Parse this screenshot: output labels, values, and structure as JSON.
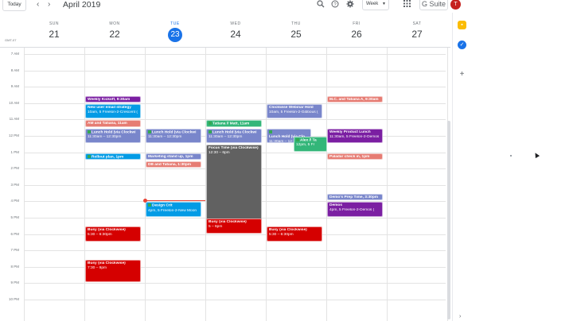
{
  "toolbar": {
    "today_label": "Today",
    "prev_icon": "chevron-left-icon",
    "next_icon": "chevron-right-icon",
    "month_title": "April 2019",
    "search_icon": "search-icon",
    "help_icon": "help-icon",
    "settings_icon": "gear-icon",
    "view_label": "Week",
    "apps_icon": "apps-grid-icon",
    "suite_label": "G Suite",
    "avatar_initial": "T"
  },
  "timezone": "GMT-07",
  "days": [
    {
      "dow": "SUN",
      "num": "21",
      "today": false
    },
    {
      "dow": "MON",
      "num": "22",
      "today": false
    },
    {
      "dow": "TUE",
      "num": "23",
      "today": true
    },
    {
      "dow": "WED",
      "num": "24",
      "today": false
    },
    {
      "dow": "THU",
      "num": "25",
      "today": false
    },
    {
      "dow": "FRI",
      "num": "26",
      "today": false
    },
    {
      "dow": "SAT",
      "num": "27",
      "today": false
    }
  ],
  "hours": [
    "7 AM",
    "8 AM",
    "9 AM",
    "10 AM",
    "11 AM",
    "12 PM",
    "1 PM",
    "2 PM",
    "3 PM",
    "4 PM",
    "5 PM",
    "6 PM",
    "7 PM",
    "8 PM",
    "9 PM",
    "10 PM"
  ],
  "colors": {
    "purple": "#7b1fa2",
    "blue": "#039be5",
    "red_light": "#e67c73",
    "lavender": "#7986cb",
    "green": "#33b679",
    "red": "#d50000",
    "graphite": "#616161",
    "today_blue": "#1a73e8",
    "now_red": "#ea4335"
  },
  "events": [
    {
      "title": "Weekly Kickoff, 9:30am",
      "sub": "",
      "flag": false
    },
    {
      "title": "New user email strategy",
      "sub": "10am, 5 Freelon-2-Crescent (",
      "flag": false
    },
    {
      "title": "AM and Tatiana, 11am",
      "sub": "",
      "flag": false
    },
    {
      "title": "Lunch Hold (via Clockwi",
      "sub": "11:30am – 12:30pm",
      "flag": true
    },
    {
      "title": "Rollout plan, 1pm",
      "sub": "",
      "flag": true
    },
    {
      "title": "Busy (via Clockwise)",
      "sub": "5:30 – 6:30pm",
      "flag": false
    },
    {
      "title": "Busy (via Clockwise)",
      "sub": "7:30 – 9pm",
      "flag": false
    },
    {
      "title": "Lunch Hold (via Clockwi",
      "sub": "11:30am – 12:30pm",
      "flag": true
    },
    {
      "title": "Marketing stand up, 1pm",
      "sub": "",
      "flag": false
    },
    {
      "title": "DB and Tatiana, 1:30pm",
      "sub": "",
      "flag": false
    },
    {
      "title": "Design Crit",
      "sub": "4pm, 5 Freelon-2-New Moon",
      "flag": true
    },
    {
      "title": "Tatiana // Matt, 11am",
      "sub": "",
      "flag": true
    },
    {
      "title": "Lunch Hold (via Clockwi",
      "sub": "11:30am – 12:30pm",
      "flag": true
    },
    {
      "title": "Focus Time (via Clockwise)",
      "sub": "12:30 – 6pm",
      "flag": false
    },
    {
      "title": "Busy (via Clockwise)",
      "sub": "5 – 6pm",
      "flag": false
    },
    {
      "title": "Clockwise Webinar Hold",
      "sub": "10am, 5 Freelon-2-Gibbous (",
      "flag": false
    },
    {
      "title": "Lunch Hold (via Clo",
      "sub": "11:30am – 12:30",
      "flag": true
    },
    {
      "title": "Alex // Ta",
      "sub": "12pm, 5 Fr",
      "flag": true
    },
    {
      "title": "Busy (via Clockwise)",
      "sub": "5:30 – 6:30pm",
      "flag": false
    },
    {
      "title": "M.C. and Tatiana A, 9:30am",
      "sub": "",
      "flag": false
    },
    {
      "title": "Weekly Product Lunch",
      "sub": "11:30am, 5 Freelon-2-Demos",
      "flag": false
    },
    {
      "title": "Paladar check in, 1pm",
      "sub": "",
      "flag": false
    },
    {
      "title": "Demo's Prep Time, 3:30pm",
      "sub": "",
      "flag": false
    },
    {
      "title": "Demos",
      "sub": "4pm, 5 Freelon-2-Demos (",
      "flag": false
    }
  ],
  "side_panel": {
    "keep_icon": "keep-icon",
    "tasks_icon": "tasks-icon",
    "add_icon": "plus-icon",
    "expand_icon": "chevron-right-icon"
  }
}
